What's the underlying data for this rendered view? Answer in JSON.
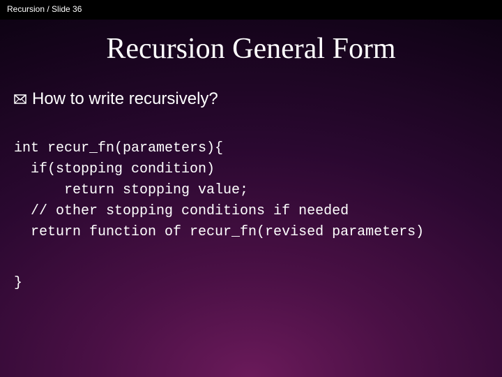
{
  "header": {
    "breadcrumb": "Recursion / Slide 36"
  },
  "title": "Recursion General Form",
  "bullet": {
    "icon_name": "envelope-icon",
    "text": "How to write recursively?"
  },
  "code": {
    "lines": "int recur_fn(parameters){\n  if(stopping condition)\n      return stopping value;\n  // other stopping conditions if needed\n  return function of recur_fn(revised parameters)",
    "closing": "}"
  }
}
